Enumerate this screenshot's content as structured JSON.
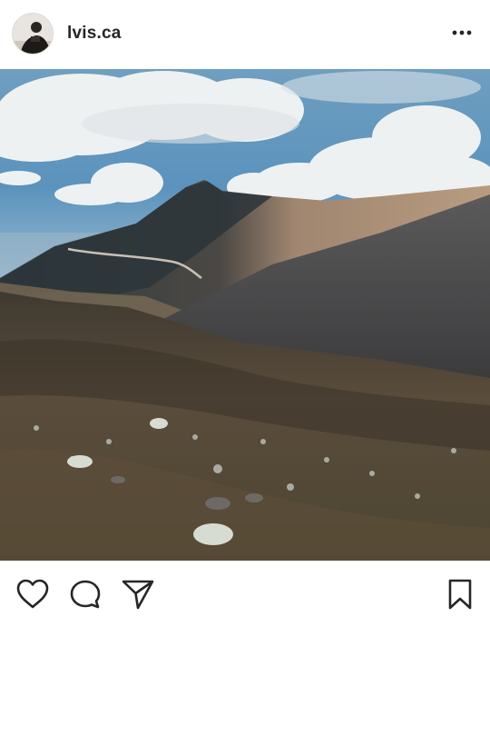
{
  "post": {
    "username": "lvis.ca",
    "avatar_icon": "user-avatar",
    "image_description_icon": "mountain-landscape-photo"
  },
  "actions": {
    "like_icon": "heart-icon",
    "comment_icon": "comment-bubble-icon",
    "share_icon": "send-paper-plane-icon",
    "save_icon": "bookmark-icon",
    "more_icon": "more-dots-icon"
  },
  "colors": {
    "text": "#262626",
    "background": "#ffffff",
    "icon": "#262626"
  }
}
